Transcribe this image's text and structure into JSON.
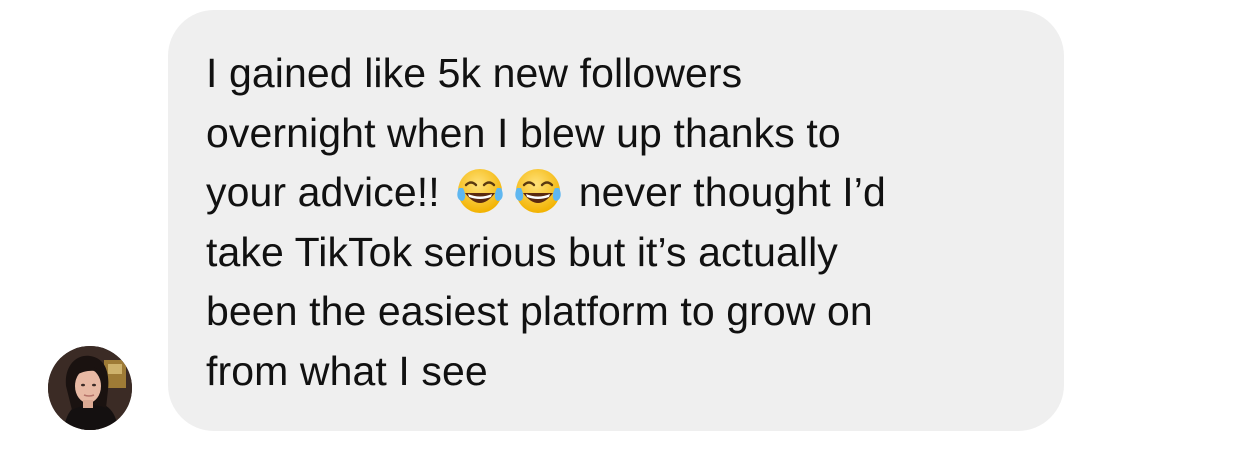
{
  "conversation": {
    "message": {
      "lines": [
        "I gained like 5k new followers",
        "overnight when I blew up thanks to",
        "your advice!!",
        "never thought I’d",
        "take TikTok serious but it’s actually",
        "been the easiest platform to grow on",
        "from what I see"
      ],
      "emoji_icon": "face-with-tears-of-joy-emoji"
    },
    "sender": {
      "avatar_icon": "profile-photo-avatar"
    },
    "colors": {
      "bubble": "#efefef",
      "text": "#111111",
      "background": "#ffffff"
    }
  }
}
